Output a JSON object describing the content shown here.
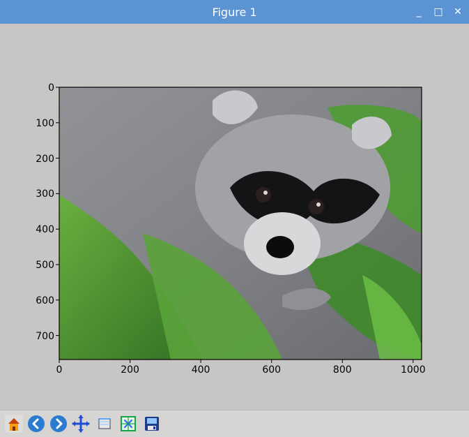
{
  "window": {
    "title": "Figure 1",
    "controls": {
      "minimize": "_",
      "maximize": "□",
      "close": "✕"
    }
  },
  "image": {
    "subject": "raccoon-among-palm-leaves"
  },
  "chart_data": {
    "type": "image",
    "title": "",
    "xlabel": "",
    "ylabel": "",
    "xlim": [
      0,
      1024
    ],
    "ylim": [
      768,
      0
    ],
    "xticks": [
      0,
      200,
      400,
      600,
      800,
      1000
    ],
    "yticks": [
      0,
      100,
      200,
      300,
      400,
      500,
      600,
      700
    ],
    "xtick_labels": [
      "0",
      "200",
      "400",
      "600",
      "800",
      "1000"
    ],
    "ytick_labels": [
      "0",
      "100",
      "200",
      "300",
      "400",
      "500",
      "600",
      "700"
    ]
  },
  "toolbar": {
    "buttons": [
      {
        "name": "home-icon"
      },
      {
        "name": "back-icon"
      },
      {
        "name": "forward-icon"
      },
      {
        "name": "pan-icon"
      },
      {
        "name": "zoom-icon"
      },
      {
        "name": "subplots-icon"
      },
      {
        "name": "save-icon"
      }
    ]
  },
  "colors": {
    "titlebar": "#5b93d3",
    "background": "#c8c6c4",
    "toolbar": "#d7d5d3"
  }
}
